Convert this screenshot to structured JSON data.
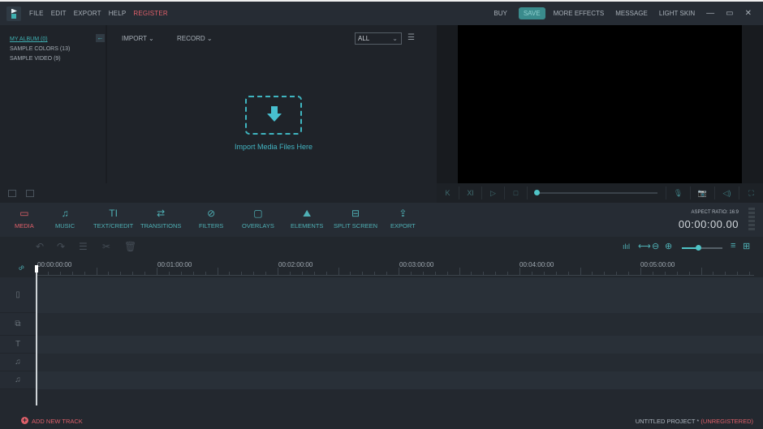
{
  "titlebar": {
    "menus": [
      "FILE",
      "EDIT",
      "EXPORT",
      "HELP"
    ],
    "register": "REGISTER",
    "buy": "BUY",
    "save": "SAVE",
    "more_effects": "MORE EFFECTS",
    "message": "MESSAGE",
    "light_skin": "LIGHT SKIN",
    "minimize": "—",
    "maximize": "▭",
    "close": "✕"
  },
  "library": {
    "albums": [
      {
        "label": "MY ALBUM (0)",
        "selected": true
      },
      {
        "label": "SAMPLE COLORS (13)",
        "selected": false
      },
      {
        "label": "SAMPLE VIDEO (9)",
        "selected": false
      }
    ],
    "back_icon": "←"
  },
  "media": {
    "import_label": "IMPORT ⌄",
    "record_label": "RECORD ⌄",
    "filter_value": "ALL",
    "filter_chevron": "⌄",
    "list_icon": "☰",
    "drop_text": "Import Media Files Here"
  },
  "player": {
    "buttons": [
      "K",
      "Ⅺ",
      "▷",
      "□"
    ],
    "progress": 0,
    "right_icons": [
      "🎙",
      "📷",
      "◁)",
      "⛶"
    ]
  },
  "toolbar": {
    "tools": [
      {
        "label": "MEDIA",
        "icon": "▭",
        "active": true
      },
      {
        "label": "MUSIC",
        "icon": "♫",
        "active": false
      },
      {
        "label": "TEXT/CREDIT",
        "icon": "TI",
        "active": false
      },
      {
        "label": "TRANSITIONS",
        "icon": "⇄",
        "active": false
      },
      {
        "label": "FILTERS",
        "icon": "⊘",
        "active": false
      },
      {
        "label": "OVERLAYS",
        "icon": "▢",
        "active": false
      },
      {
        "label": "ELEMENTS",
        "icon": "⛰",
        "active": false
      },
      {
        "label": "SPLIT SCREEN",
        "icon": "⊟",
        "active": false
      },
      {
        "label": "EXPORT",
        "icon": "⇪",
        "active": false
      }
    ],
    "aspect_ratio": "ASPECT RATIO: 16:9",
    "timecode": "00:00:00.00"
  },
  "edit_tools": {
    "undo": "↶",
    "redo": "↷",
    "adjust": "☰",
    "cut": "✂",
    "delete": "🗑",
    "audio_mixer": "ılıl",
    "fit": "⟷",
    "zoom_out": "⊖",
    "zoom_in": "⊕",
    "zoom_level": 0.4,
    "list_view": "≡",
    "grid_view": "⊞"
  },
  "ruler": {
    "labels": [
      "00:00:00:00",
      "00:01:00:00",
      "00:02:00:00",
      "00:03:00:00",
      "00:04:00:00",
      "00:05:00:00"
    ]
  },
  "tracks": [
    {
      "type": "video",
      "icon": "▯"
    },
    {
      "type": "overlay",
      "icon": "⧉"
    },
    {
      "type": "text",
      "icon": "T"
    },
    {
      "type": "music",
      "icon": "♫"
    },
    {
      "type": "music",
      "icon": "♫"
    }
  ],
  "footer": {
    "add_track": "ADD NEW TRACK",
    "add_icon": "+",
    "project": "UNTITLED PROJECT *",
    "unregistered": "(UNREGISTERED)"
  },
  "colors": {
    "accent": "#4fb0b5",
    "alert": "#e0606a",
    "save_button": "#3a8b8c"
  }
}
